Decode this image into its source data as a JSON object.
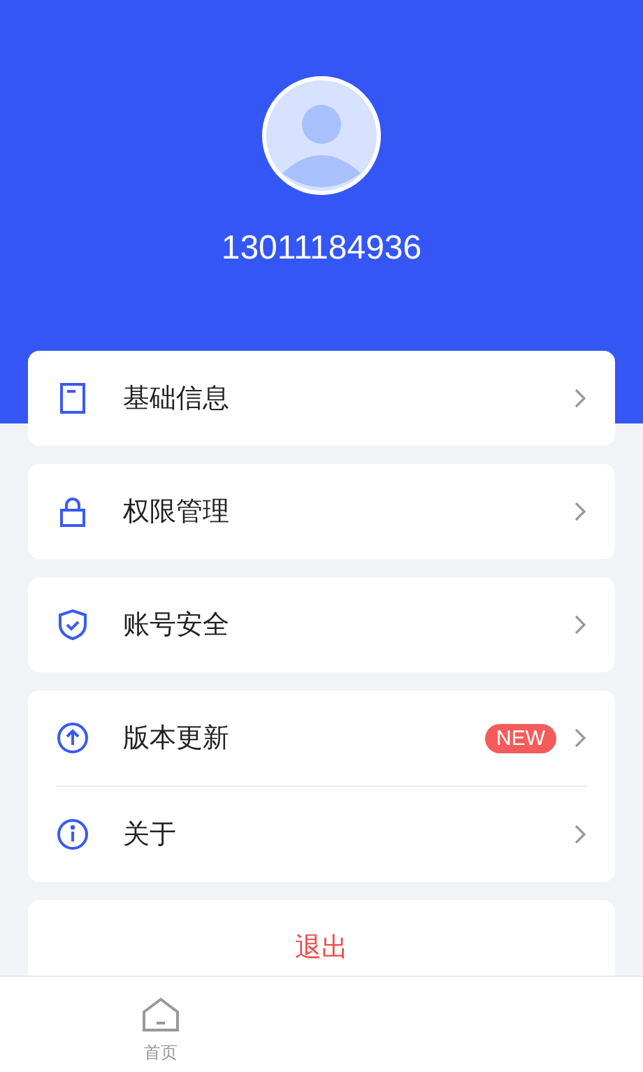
{
  "profile": {
    "phone": "13011184936"
  },
  "groups": [
    {
      "items": [
        {
          "kind": "document",
          "label": "基础信息"
        }
      ]
    },
    {
      "items": [
        {
          "kind": "lock",
          "label": "权限管理"
        }
      ]
    },
    {
      "items": [
        {
          "kind": "shield",
          "label": "账号安全"
        }
      ]
    },
    {
      "items": [
        {
          "kind": "upload",
          "label": "版本更新",
          "badge": "NEW"
        },
        {
          "kind": "info",
          "label": "关于"
        }
      ]
    }
  ],
  "logout": {
    "label": "退出"
  },
  "tabbar": [
    {
      "label": "首页",
      "selected": false
    }
  ]
}
